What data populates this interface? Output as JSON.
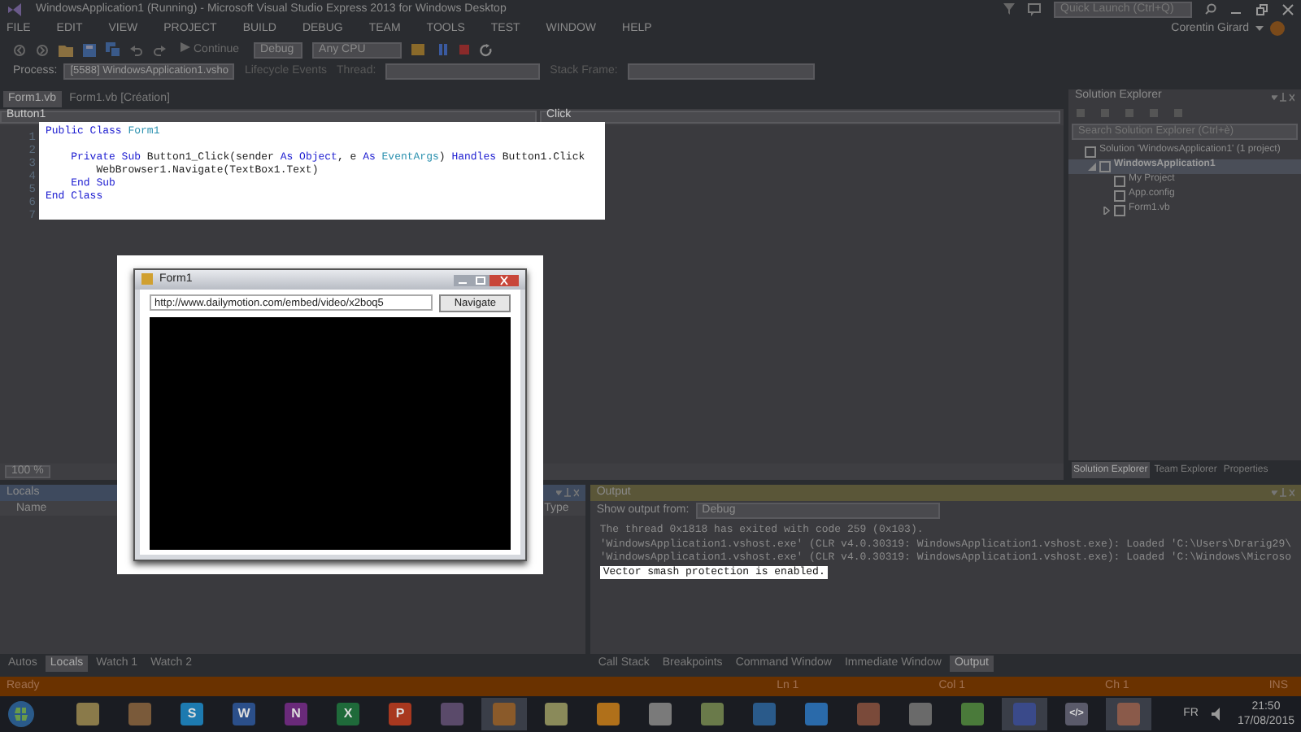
{
  "window": {
    "title": "WindowsApplication1 (Running) - Microsoft Visual Studio Express 2013 for Windows Desktop",
    "quick_launch": {
      "placeholder": "Quick Launch (Ctrl+Q)"
    },
    "user": "Corentin Girard"
  },
  "menu": [
    "FILE",
    "EDIT",
    "VIEW",
    "PROJECT",
    "BUILD",
    "DEBUG",
    "TEAM",
    "TOOLS",
    "TEST",
    "WINDOW",
    "HELP"
  ],
  "toolbar": {
    "continue": "Continue",
    "configuration": "Debug",
    "platform": "Any CPU"
  },
  "debug_location": {
    "process_label": "Process:",
    "process": "[5588] WindowsApplication1.vsho",
    "lifecycle": "Lifecycle Events",
    "thread_label": "Thread:",
    "stack_frame_label": "Stack Frame:"
  },
  "editor": {
    "tabs": [
      {
        "label": "Form1.vb",
        "selected": true
      },
      {
        "label": "Form1.vb [Création]",
        "selected": false
      }
    ],
    "class_dropdown": "Button1",
    "method_dropdown": "Click",
    "lines": [
      {
        "number": "1",
        "tokens": [
          {
            "text": "Public Class ",
            "kind": "keyword"
          },
          {
            "text": "Form1",
            "kind": "type"
          }
        ]
      },
      {
        "number": "2"
      },
      {
        "number": "3",
        "tokens": [
          {
            "text": "    Private Sub ",
            "kind": "keyword"
          },
          {
            "text": "Button1_Click(sender ",
            "kind": "plain"
          },
          {
            "text": "As Object",
            "kind": "keyword"
          },
          {
            "text": ", e ",
            "kind": "plain"
          },
          {
            "text": "As ",
            "kind": "keyword"
          },
          {
            "text": "EventArgs",
            "kind": "type"
          },
          {
            "text": ") ",
            "kind": "plain"
          },
          {
            "text": "Handles ",
            "kind": "keyword"
          },
          {
            "text": "Button1.Click",
            "kind": "plain"
          }
        ]
      },
      {
        "number": "4",
        "tokens": [
          {
            "text": "        WebBrowser1.Navigate(TextBox1.Text)",
            "kind": "plain"
          }
        ]
      },
      {
        "number": "5",
        "tokens": [
          {
            "text": "    End Sub",
            "kind": "keyword"
          }
        ]
      },
      {
        "number": "6",
        "tokens": [
          {
            "text": "End Class",
            "kind": "keyword"
          }
        ]
      },
      {
        "number": "7"
      }
    ],
    "zoom": "100 %"
  },
  "solution_explorer": {
    "title": "Solution Explorer",
    "search": {
      "placeholder": "Search Solution Explorer (Ctrl+è)"
    },
    "tree": [
      {
        "label": "Solution 'WindowsApplication1' (1 project)",
        "selected": false,
        "children": [
          {
            "label": "WindowsApplication1",
            "selected": true,
            "expanded": true,
            "children": [
              {
                "label": "My Project",
                "selected": false
              },
              {
                "label": "App.config",
                "selected": false
              },
              {
                "label": "Form1.vb",
                "selected": false,
                "expanded": false
              }
            ]
          }
        ]
      }
    ],
    "tabs": [
      {
        "label": "Solution Explorer",
        "selected": true
      },
      {
        "label": "Team Explorer",
        "selected": false
      },
      {
        "label": "Properties",
        "selected": false
      }
    ]
  },
  "locals": {
    "title": "Locals",
    "columns": [
      "Name",
      "Type"
    ],
    "tabs": [
      {
        "label": "Autos",
        "selected": false
      },
      {
        "label": "Locals",
        "selected": true
      },
      {
        "label": "Watch 1",
        "selected": false
      },
      {
        "label": "Watch 2",
        "selected": false
      }
    ]
  },
  "output": {
    "title": "Output",
    "source_label": "Show output from:",
    "source": "Debug",
    "lines": [
      {
        "text": "The thread 0x1818 has exited with code 259 (0x103).",
        "highlighted": false
      },
      {
        "text": "'WindowsApplication1.vshost.exe' (CLR v4.0.30319: WindowsApplication1.vshost.exe): Loaded 'C:\\Users\\Drarig29\\",
        "highlighted": false
      },
      {
        "text": "'WindowsApplication1.vshost.exe' (CLR v4.0.30319: WindowsApplication1.vshost.exe): Loaded 'C:\\Windows\\Microso",
        "highlighted": false
      },
      {
        "text": "Vector smash protection is enabled.",
        "highlighted": true
      }
    ],
    "tabs": [
      {
        "label": "Call Stack",
        "selected": false
      },
      {
        "label": "Breakpoints",
        "selected": false
      },
      {
        "label": "Command Window",
        "selected": false
      },
      {
        "label": "Immediate Window",
        "selected": false
      },
      {
        "label": "Output",
        "selected": true
      }
    ]
  },
  "status_bar": {
    "text": "Ready",
    "ln": "Ln 1",
    "col": "Col 1",
    "ch": "Ch 1",
    "mode": "INS"
  },
  "form_window": {
    "title": "Form1",
    "url": "http://www.dailymotion.com/embed/video/x2boq5",
    "button": "Navigate"
  },
  "taskbar": {
    "apps": [
      {
        "color": "#8a7a4a",
        "active": false
      },
      {
        "color": "#7a5a3a",
        "active": false
      },
      {
        "glyph": "S",
        "color": "#1d7ab0",
        "active": false
      },
      {
        "glyph": "W",
        "color": "#2b4f8a",
        "active": false
      },
      {
        "glyph": "N",
        "color": "#6a2a7a",
        "active": false
      },
      {
        "glyph": "X",
        "color": "#1f6a3a",
        "active": false
      },
      {
        "glyph": "P",
        "color": "#a8381f",
        "active": false
      },
      {
        "color": "#5a4a6a",
        "active": false
      },
      {
        "color": "#8a5a2a",
        "active": true
      },
      {
        "color": "#8a8a5a",
        "active": false
      },
      {
        "color": "#b0701a",
        "active": false
      },
      {
        "color": "#7a7a7a",
        "active": false
      },
      {
        "color": "#6a7a4a",
        "active": false
      },
      {
        "color": "#2a5a8a",
        "active": false
      },
      {
        "color": "#2a6aaa",
        "active": false
      },
      {
        "color": "#7a4a3a",
        "active": false
      },
      {
        "color": "#6a6a6a",
        "active": false
      },
      {
        "color": "#4a7a3a",
        "active": false
      },
      {
        "color": "#3a4a8a",
        "active": true
      },
      {
        "glyph": "</>",
        "color": "#5a5a6a",
        "active": false
      },
      {
        "color": "#8a5a4a",
        "active": true
      }
    ],
    "language": "FR",
    "time": "21:50",
    "date": "17/08/2015"
  }
}
